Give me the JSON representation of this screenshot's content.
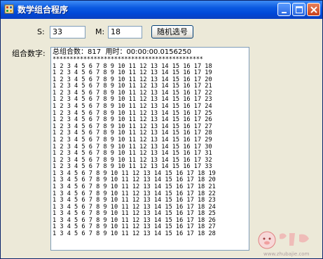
{
  "window": {
    "title": "数学组合程序"
  },
  "form": {
    "s_label": "S:",
    "s_value": "33",
    "m_label": "M:",
    "m_value": "18",
    "random_button": "随机选号",
    "result_label": "组合数字:"
  },
  "result": {
    "header": "总组合数：817  用时：00:00:00.0156250",
    "separator": "********************************************",
    "lines": [
      "1 2 3 4 5 6 7 8 9 10 11 12 13 14 15 16 17 18",
      "1 2 3 4 5 6 7 8 9 10 11 12 13 14 15 16 17 19",
      "1 2 3 4 5 6 7 8 9 10 11 12 13 14 15 16 17 20",
      "1 2 3 4 5 6 7 8 9 10 11 12 13 14 15 16 17 21",
      "1 2 3 4 5 6 7 8 9 10 11 12 13 14 15 16 17 22",
      "1 2 3 4 5 6 7 8 9 10 11 12 13 14 15 16 17 23",
      "1 2 3 4 5 6 7 8 9 10 11 12 13 14 15 16 17 24",
      "1 2 3 4 5 6 7 8 9 10 11 12 13 14 15 16 17 25",
      "1 2 3 4 5 6 7 8 9 10 11 12 13 14 15 16 17 26",
      "1 2 3 4 5 6 7 8 9 10 11 12 13 14 15 16 17 27",
      "1 2 3 4 5 6 7 8 9 10 11 12 13 14 15 16 17 28",
      "1 2 3 4 5 6 7 8 9 10 11 12 13 14 15 16 17 29",
      "1 2 3 4 5 6 7 8 9 10 11 12 13 14 15 16 17 30",
      "1 2 3 4 5 6 7 8 9 10 11 12 13 14 15 16 17 31",
      "1 2 3 4 5 6 7 8 9 10 11 12 13 14 15 16 17 32",
      "1 2 3 4 5 6 7 8 9 10 11 12 13 14 15 16 17 33",
      "1 3 4 5 6 7 8 9 10 11 12 13 14 15 16 17 18 19",
      "1 3 4 5 6 7 8 9 10 11 12 13 14 15 16 17 18 20",
      "1 3 4 5 6 7 8 9 10 11 12 13 14 15 16 17 18 21",
      "1 3 4 5 6 7 8 9 10 11 12 13 14 15 16 17 18 22",
      "1 3 4 5 6 7 8 9 10 11 12 13 14 15 16 17 18 23",
      "1 3 4 5 6 7 8 9 10 11 12 13 14 15 16 17 18 24",
      "1 3 4 5 6 7 8 9 10 11 12 13 14 15 16 17 18 25",
      "1 3 4 5 6 7 8 9 10 11 12 13 14 15 16 17 18 26",
      "1 3 4 5 6 7 8 9 10 11 12 13 14 15 16 17 18 27",
      "1 3 4 5 6 7 8 9 10 11 12 13 14 15 16 17 18 28"
    ]
  },
  "watermark": {
    "text": "www.zhubajie.com"
  },
  "icons": {
    "app": "app-icon",
    "minimize": "minimize-icon",
    "maximize": "maximize-icon",
    "close": "close-icon",
    "watermark": "zhubajie-logo-icon"
  },
  "colors": {
    "titlebar": "#0a58e0",
    "dialog": "#ece9d8",
    "input_border": "#7f9db9",
    "close_button": "#c8401c"
  }
}
